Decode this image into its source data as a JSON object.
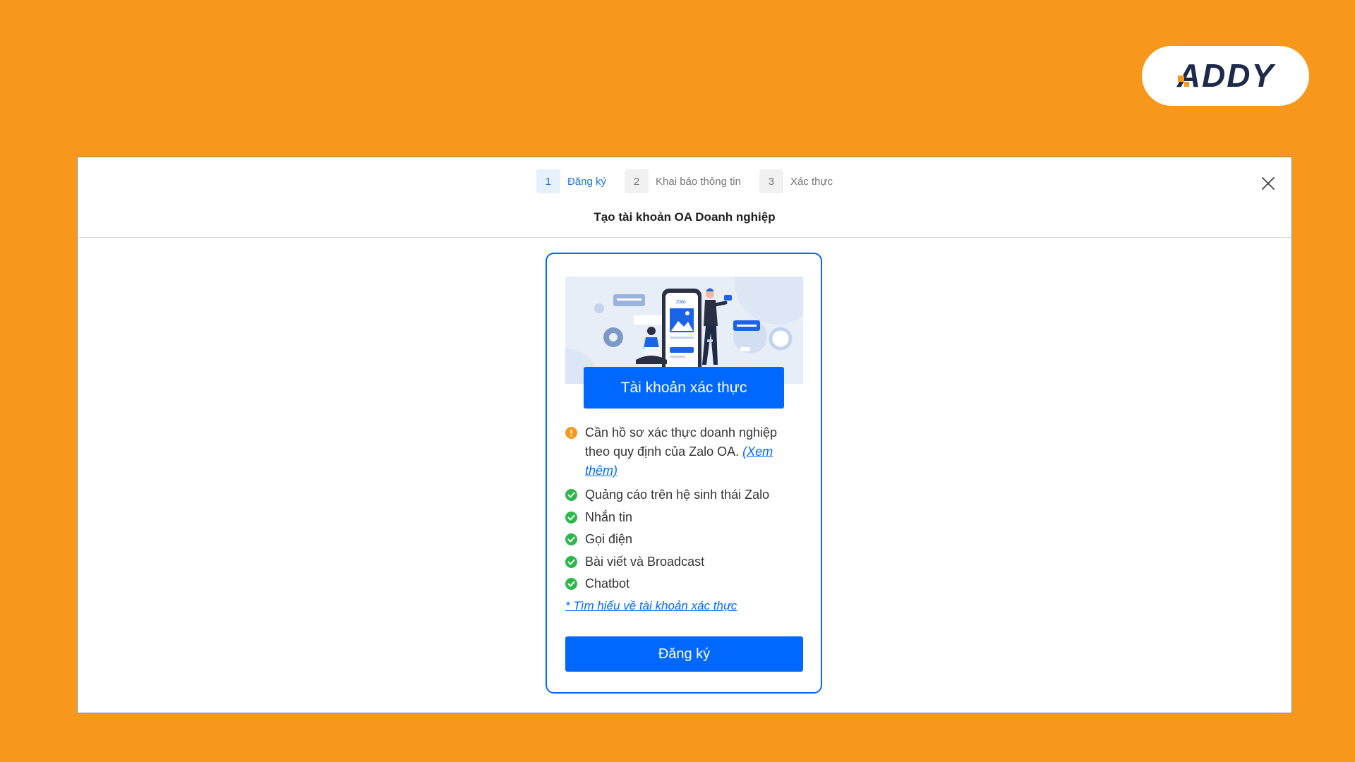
{
  "brand": {
    "logo_text": "ADDY",
    "icon": "addy-logo"
  },
  "colors": {
    "background": "#F7981D",
    "primary": "#0068FF",
    "success": "#2DB84C",
    "warning": "#F7981D"
  },
  "modal": {
    "steps": [
      {
        "number": "1",
        "label": "Đăng ký",
        "active": true
      },
      {
        "number": "2",
        "label": "Khai báo thông tin",
        "active": false
      },
      {
        "number": "3",
        "label": "Xác thực",
        "active": false
      }
    ],
    "title": "Tạo tài khoản OA Doanh nghiệp",
    "close_icon": "close-icon"
  },
  "card": {
    "illustration_phone_label": "Zalo",
    "badge": "Tài khoản xác thực",
    "requirement": {
      "text": "Cần hồ sơ xác thực doanh nghiệp theo quy định của Zalo OA. ",
      "link": "(Xem thêm)",
      "icon": "warning-icon"
    },
    "features": [
      "Quảng cáo trên hệ sinh thái Zalo",
      "Nhắn tin",
      "Gọi điện",
      "Bài viết và Broadcast",
      "Chatbot"
    ],
    "feature_icon": "check-circle-icon",
    "learn_more": "* Tìm hiểu về tài khoản xác thực",
    "register_button": "Đăng ký"
  }
}
